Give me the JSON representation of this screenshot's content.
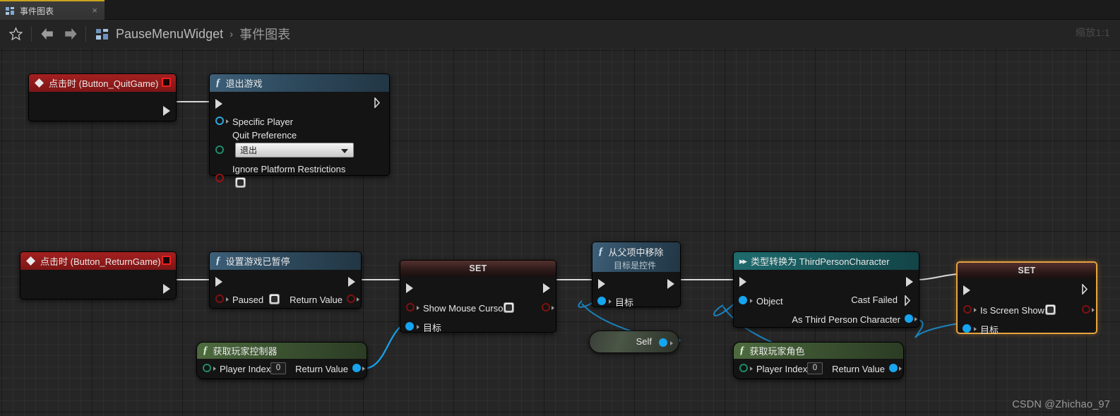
{
  "window": {
    "tab": {
      "label": "事件图表",
      "icon": "blueprint-graph-icon",
      "close": "×"
    },
    "zoom_label": "缩放1:1",
    "watermark": "CSDN @Zhichao_97"
  },
  "toolbar": {
    "favorite_icon": "star-icon",
    "back_icon": "arrow-left-icon",
    "forward_icon": "arrow-right-icon",
    "breadcrumb_icon": "blueprint-icon",
    "breadcrumb": [
      "PauseMenuWidget",
      "事件图表"
    ],
    "separator": "›"
  },
  "nodes": {
    "event_quit": {
      "title": "点击时 (Button_QuitGame)",
      "glyph": "event-diamond-icon",
      "delegate_icon": "red-square-icon"
    },
    "quit_game": {
      "title": "退出游戏",
      "glyph": "function-f-icon",
      "pins": {
        "specific_player": "Specific Player",
        "quit_preference": "Quit Preference",
        "quit_preference_value": "退出",
        "ignore_platform": "Ignore Platform Restrictions"
      }
    },
    "event_return": {
      "title": "点击时 (Button_ReturnGame)",
      "glyph": "event-diamond-icon",
      "delegate_icon": "red-square-icon"
    },
    "set_game_paused": {
      "title": "设置游戏已暂停",
      "glyph": "function-f-icon",
      "pins": {
        "paused": "Paused",
        "return_value": "Return Value"
      }
    },
    "set_mouse_cursor": {
      "title": "SET",
      "pins": {
        "show_mouse_cursor": "Show Mouse Cursor",
        "target": "目标"
      }
    },
    "get_player_controller": {
      "title": "获取玩家控制器",
      "glyph": "function-f-icon",
      "pins": {
        "player_index": "Player Index",
        "player_index_value": "0",
        "return_value": "Return Value"
      }
    },
    "remove_from_parent": {
      "title": "从父项中移除",
      "subtitle": "目标是控件",
      "glyph": "function-f-icon",
      "pins": {
        "target": "目标"
      }
    },
    "self_node": {
      "pins": {
        "self": "Self"
      }
    },
    "cast_node": {
      "title": "类型转换为 ThirdPersonCharacter",
      "glyph": "cast-arrow-icon",
      "pins": {
        "object": "Object",
        "cast_failed": "Cast Failed",
        "as_third_person_character": "As Third Person Character"
      }
    },
    "set_is_screen_show": {
      "title": "SET",
      "selected": true,
      "pins": {
        "is_screen_show": "Is Screen Show",
        "target": "目标"
      }
    },
    "get_player_character": {
      "title": "获取玩家角色",
      "glyph": "function-f-icon",
      "pins": {
        "player_index": "Player Index",
        "player_index_value": "0",
        "return_value": "Return Value"
      }
    }
  },
  "colors": {
    "canvas": "#262626",
    "event_header": "#a52020",
    "function_header": "#3d5f78",
    "pure_header": "#4e6b3f",
    "cast_header": "#1f6b6e",
    "set_header": "#53302e",
    "selection": "#e8a33d",
    "exec_wire": "#d8d8d8",
    "object_wire": "#16a5f0"
  }
}
